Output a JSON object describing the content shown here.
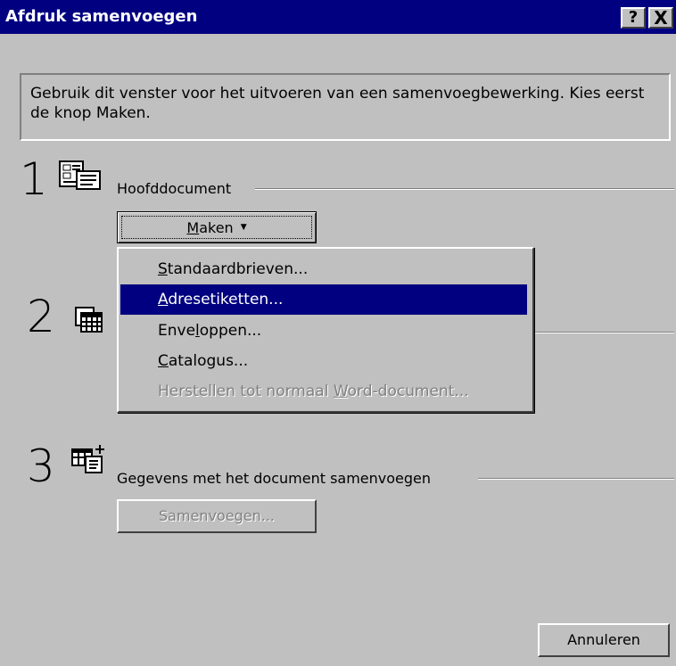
{
  "window": {
    "title": "Afdruk samenvoegen"
  },
  "titlebar": {
    "help": "?",
    "close": "X"
  },
  "info": {
    "text": "Gebruik dit venster voor het uitvoeren van een samenvoegbewerking. Kies eerst de knop Maken."
  },
  "step1": {
    "number": "1",
    "icon": "main-document-icon",
    "label": "Hoofddocument",
    "button": {
      "accel": "M",
      "rest": "aken"
    }
  },
  "step2": {
    "number": "2",
    "icon": "data-source-icon"
  },
  "step3": {
    "number": "3",
    "icon": "merge-icon",
    "label": "Gegevens met het document samenvoegen",
    "button": "Samenvoegen..."
  },
  "menu": {
    "items": [
      {
        "pre": "",
        "accel": "S",
        "post": "tandaardbrieven..."
      },
      {
        "pre": "",
        "accel": "A",
        "post": "dresetiketten..."
      },
      {
        "pre": "Enve",
        "accel": "l",
        "post": "oppen..."
      },
      {
        "pre": "",
        "accel": "C",
        "post": "atalogus..."
      },
      {
        "pre": "Herstellen tot normaal ",
        "accel": "W",
        "post": "ord-document..."
      }
    ],
    "selected_index": 1
  },
  "cancel": "Annuleren",
  "colors": {
    "titlebar": "#000080",
    "face": "#c0c0c0",
    "highlight": "#000080"
  }
}
